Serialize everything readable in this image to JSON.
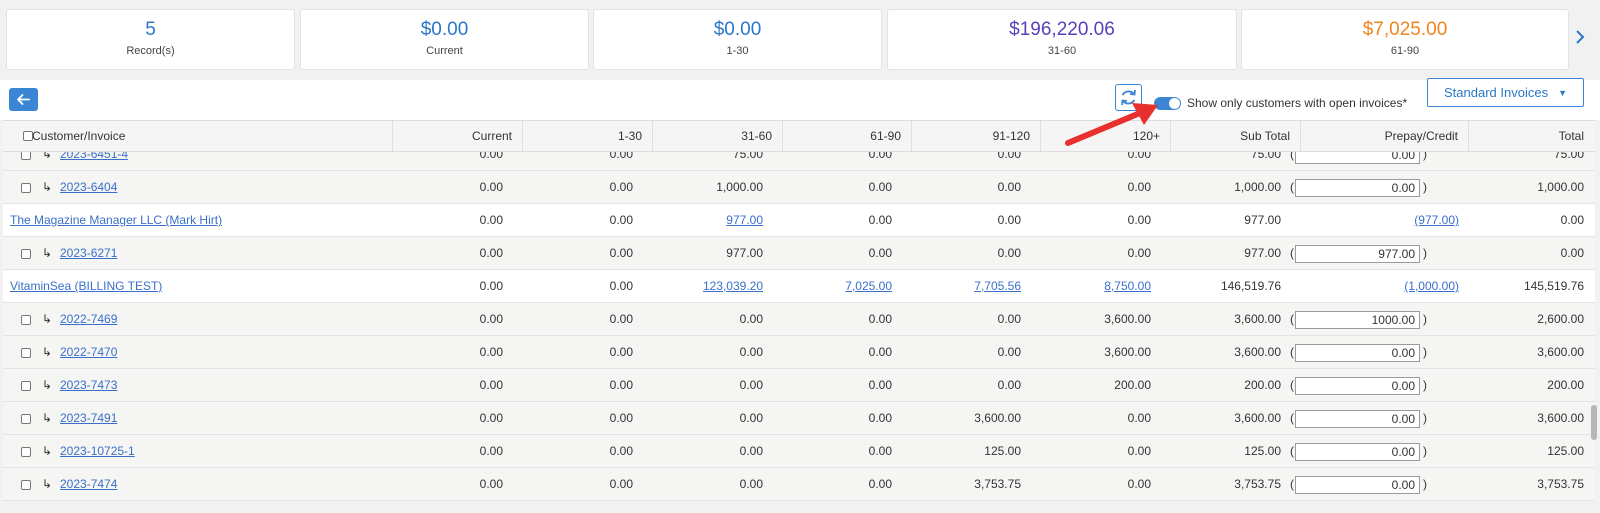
{
  "summary_cards": [
    {
      "value": "5",
      "label": "Record(s)",
      "color": "#2a77c9"
    },
    {
      "value": "$0.00",
      "label": "Current",
      "color": "#2a77c9"
    },
    {
      "value": "$0.00",
      "label": "1-30",
      "color": "#2a77c9"
    },
    {
      "value": "$196,220.06",
      "label": "31-60",
      "color": "#5a3fb8"
    },
    {
      "value": "$7,025.00",
      "label": "61-90",
      "color": "#f0841f"
    }
  ],
  "toolbar": {
    "toggle_label": "Show only customers with open invoices*",
    "toggle_on": true,
    "invoice_type": "Standard Invoices"
  },
  "table": {
    "columns": [
      "Customer/Invoice",
      "Current",
      "1-30",
      "31-60",
      "61-90",
      "91-120",
      "120+",
      "Sub Total",
      "Prepay/Credit",
      "Total"
    ],
    "rows": [
      {
        "kind": "invoice",
        "name": "2023-6451-4",
        "cells": [
          "0.00",
          "0.00",
          "75.00",
          "0.00",
          "0.00",
          "0.00",
          "75.00"
        ],
        "prepay": "0.00",
        "total": "75.00"
      },
      {
        "kind": "invoice",
        "name": "2023-6404",
        "cells": [
          "0.00",
          "0.00",
          "1,000.00",
          "0.00",
          "0.00",
          "0.00",
          "1,000.00"
        ],
        "prepay": "0.00",
        "total": "1,000.00"
      },
      {
        "kind": "customer",
        "name": "The Magazine Manager LLC (Mark Hirt)",
        "cells": [
          "0.00",
          "0.00",
          "977.00",
          "0.00",
          "0.00",
          "0.00",
          "977.00"
        ],
        "links": [
          2
        ],
        "prepay": "(977.00)",
        "total": "0.00"
      },
      {
        "kind": "invoice",
        "name": "2023-6271",
        "cells": [
          "0.00",
          "0.00",
          "977.00",
          "0.00",
          "0.00",
          "0.00",
          "977.00"
        ],
        "prepay": "977.00",
        "total": "0.00"
      },
      {
        "kind": "customer",
        "name": "VitaminSea (BILLING TEST)",
        "cells": [
          "0.00",
          "0.00",
          "123,039.20",
          "7,025.00",
          "7,705.56",
          "8,750.00",
          "146,519.76"
        ],
        "links": [
          2,
          3,
          4,
          5
        ],
        "prepay": "(1,000.00)",
        "total": "145,519.76"
      },
      {
        "kind": "invoice",
        "name": "2022-7469",
        "cells": [
          "0.00",
          "0.00",
          "0.00",
          "0.00",
          "0.00",
          "3,600.00",
          "3,600.00"
        ],
        "prepay": "1000.00",
        "total": "2,600.00"
      },
      {
        "kind": "invoice",
        "name": "2022-7470",
        "cells": [
          "0.00",
          "0.00",
          "0.00",
          "0.00",
          "0.00",
          "3,600.00",
          "3,600.00"
        ],
        "prepay": "0.00",
        "total": "3,600.00"
      },
      {
        "kind": "invoice",
        "name": "2023-7473",
        "cells": [
          "0.00",
          "0.00",
          "0.00",
          "0.00",
          "0.00",
          "200.00",
          "200.00"
        ],
        "prepay": "0.00",
        "total": "200.00"
      },
      {
        "kind": "invoice",
        "name": "2023-7491",
        "cells": [
          "0.00",
          "0.00",
          "0.00",
          "0.00",
          "3,600.00",
          "0.00",
          "3,600.00"
        ],
        "prepay": "0.00",
        "total": "3,600.00"
      },
      {
        "kind": "invoice",
        "name": "2023-10725-1",
        "cells": [
          "0.00",
          "0.00",
          "0.00",
          "0.00",
          "125.00",
          "0.00",
          "125.00"
        ],
        "prepay": "0.00",
        "total": "125.00"
      },
      {
        "kind": "invoice",
        "name": "2023-7474",
        "cells": [
          "0.00",
          "0.00",
          "0.00",
          "0.00",
          "3,753.75",
          "0.00",
          "3,753.75"
        ],
        "prepay": "0.00",
        "total": "3,753.75"
      }
    ]
  },
  "icons": {
    "next": "chevron-right-icon",
    "back": "arrow-left-icon",
    "refresh": "refresh-icon",
    "dropdown": "caret-down-icon",
    "sub_row": "sub-row-arrow-icon",
    "annotation": "red-arrow-annotation"
  },
  "accent_color": "#3a86d4",
  "annotation_color": "#e8312f"
}
